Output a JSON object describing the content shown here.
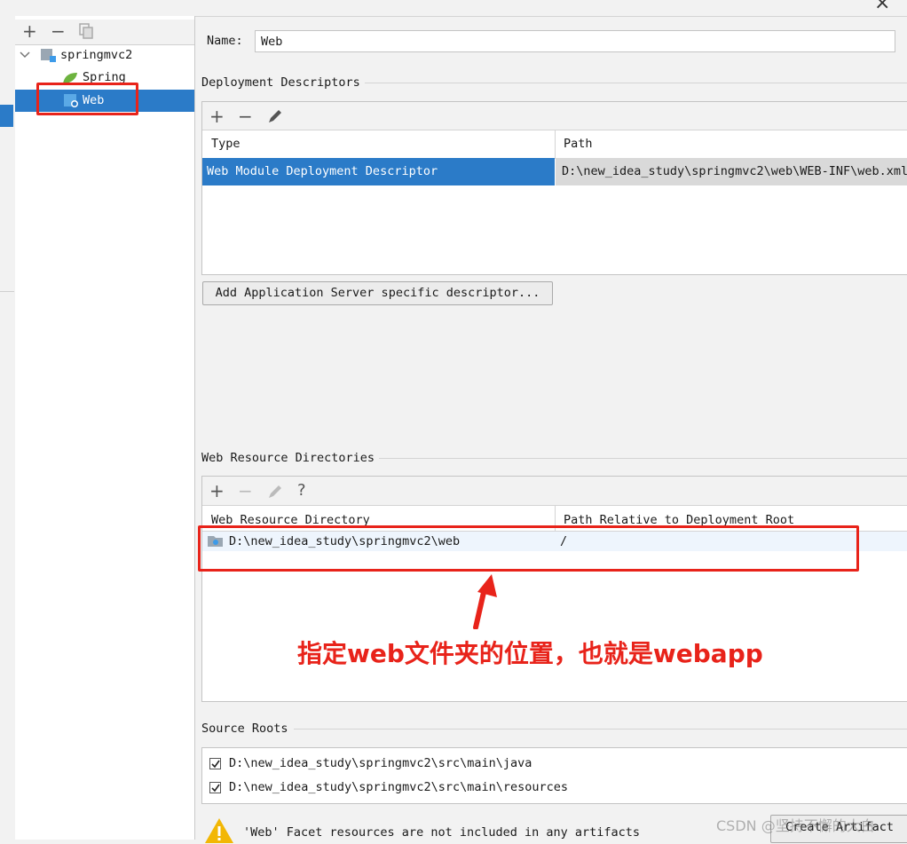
{
  "window": {
    "close_glyph": "×"
  },
  "tree": {
    "toolbar": {
      "add": "+",
      "remove": "−"
    },
    "root_label": "springmvc2",
    "items": [
      {
        "label": "Spring",
        "icon": "spring-leaf-icon"
      },
      {
        "label": "Web",
        "icon": "web-facet-icon",
        "selected": true
      }
    ]
  },
  "name_field": {
    "label": "Name:",
    "value": "Web"
  },
  "deployment_descriptors": {
    "title": "Deployment Descriptors",
    "toolbar": {
      "add": "+",
      "remove": "−"
    },
    "columns": [
      "Type",
      "Path"
    ],
    "rows": [
      {
        "type": "Web Module Deployment Descriptor",
        "path": "D:\\new_idea_study\\springmvc2\\web\\WEB-INF\\web.xml"
      }
    ],
    "add_server_button": "Add Application Server specific descriptor..."
  },
  "web_resource_directories": {
    "title": "Web Resource Directories",
    "toolbar": {
      "add": "+",
      "remove": "−",
      "help": "?"
    },
    "columns": [
      "Web Resource Directory",
      "Path Relative to Deployment Root"
    ],
    "rows": [
      {
        "directory": "D:\\new_idea_study\\springmvc2\\web",
        "relative_path": "/"
      }
    ]
  },
  "annotation": {
    "text": "指定web文件夹的位置，也就是webapp",
    "color": "#e8231a"
  },
  "source_roots": {
    "title": "Source Roots",
    "items": [
      {
        "checked": true,
        "path": "D:\\new_idea_study\\springmvc2\\src\\main\\java"
      },
      {
        "checked": true,
        "path": "D:\\new_idea_study\\springmvc2\\src\\main\\resources"
      }
    ]
  },
  "warning": {
    "text": "'Web' Facet resources are not included in any artifacts",
    "button": "Create Artifact"
  },
  "watermark": "CSDN @坚持不懈的大白",
  "colors": {
    "selection": "#2b7bc8",
    "highlight_box": "#e8231a"
  }
}
